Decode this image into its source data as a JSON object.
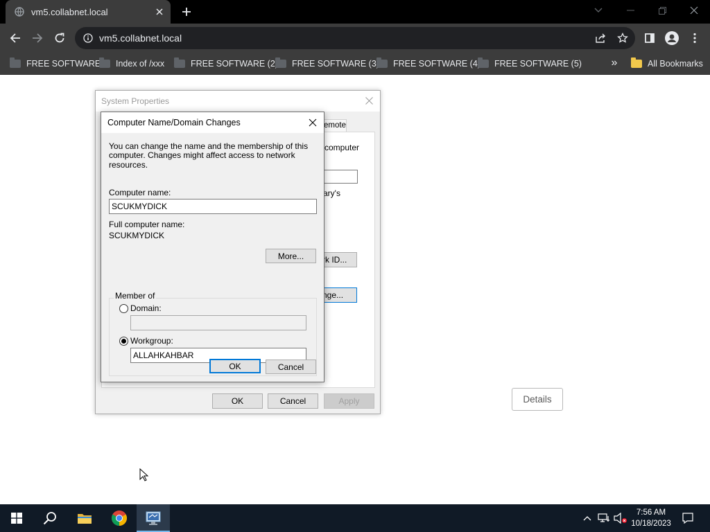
{
  "browser": {
    "tab_title": "vm5.collabnet.local",
    "url": "vm5.collabnet.local",
    "bookmarks": [
      {
        "label": "FREE SOFTWARE"
      },
      {
        "label": "Index of /xxx"
      },
      {
        "label": "FREE SOFTWARE (2)"
      },
      {
        "label": "FREE SOFTWARE (3)"
      },
      {
        "label": "FREE SOFTWARE (4)"
      },
      {
        "label": "FREE SOFTWARE (5)"
      }
    ],
    "overflow_label": "»",
    "all_bookmarks": "All Bookmarks"
  },
  "page": {
    "details_label": "Details"
  },
  "system_properties": {
    "title": "System Properties",
    "tab_remote": "emote",
    "text_computer": "computer",
    "text_arys": "ary's",
    "network_id_btn": "rk ID...",
    "change_btn": "nge...",
    "ok": "OK",
    "cancel": "Cancel",
    "apply": "Apply"
  },
  "dialog": {
    "title": "Computer Name/Domain Changes",
    "intro_line1": "You can change the name and the membership of this",
    "intro_line2": "computer. Changes might affect access to network resources.",
    "computer_name_label": "Computer name:",
    "computer_name_value": "SCUKMYDICK",
    "full_name_label": "Full computer name:",
    "full_name_value": "SCUKMYDICK",
    "more_btn": "More...",
    "member_of_label": "Member of",
    "domain_label": "Domain:",
    "domain_value": "",
    "workgroup_label": "Workgroup:",
    "workgroup_value": "ALLAHKAHBAR",
    "ok": "OK",
    "cancel": "Cancel",
    "selected_membership": "workgroup"
  },
  "taskbar": {
    "time": "7:56 AM",
    "date": "10/18/2023"
  },
  "colors": {
    "browser_dark": "#3c3c3c",
    "accent_focus": "#0078d7",
    "taskbar": "#101a26"
  }
}
